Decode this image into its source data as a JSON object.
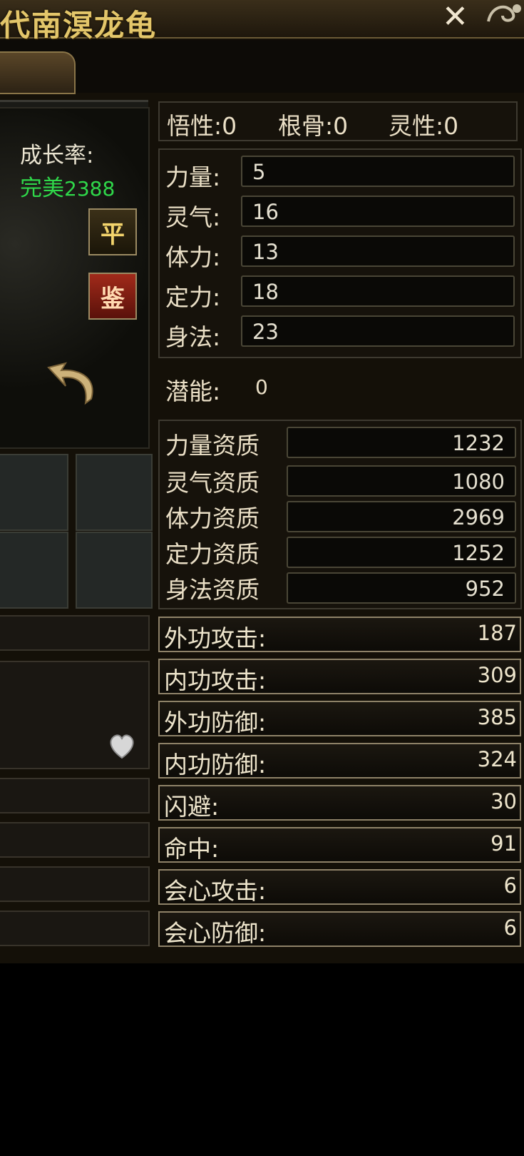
{
  "window": {
    "title": "代南溟龙龟",
    "close_glyph": "✕"
  },
  "top_stats": {
    "wuxing": "悟性:0",
    "gengu": "根骨:0",
    "lingxing": "灵性:0"
  },
  "growth": {
    "label": "成长率:",
    "grade": "完美",
    "value": "2388"
  },
  "buttons": {
    "ping": "平",
    "jian": "鉴"
  },
  "attributes": [
    {
      "label": "力量:",
      "value": "5"
    },
    {
      "label": "灵气:",
      "value": "16"
    },
    {
      "label": "体力:",
      "value": "13"
    },
    {
      "label": "定力:",
      "value": "18"
    },
    {
      "label": "身法:",
      "value": "23"
    }
  ],
  "potential": {
    "label": "潜能:",
    "value": "0"
  },
  "aptitudes": [
    {
      "label": "力量资质",
      "value": "1232"
    },
    {
      "label": "灵气资质",
      "value": "1080"
    },
    {
      "label": "体力资质",
      "value": "2969"
    },
    {
      "label": "定力资质",
      "value": "1252"
    },
    {
      "label": "身法资质",
      "value": "952"
    }
  ],
  "battle": [
    {
      "label": "外功攻击:",
      "value": "187"
    },
    {
      "label": "内功攻击:",
      "value": "309"
    },
    {
      "label": "外功防御:",
      "value": "385"
    },
    {
      "label": "内功防御:",
      "value": "324"
    },
    {
      "label": "闪避:",
      "value": "30"
    },
    {
      "label": "命中:",
      "value": "91"
    },
    {
      "label": "会心攻击:",
      "value": "6"
    },
    {
      "label": "会心防御:",
      "value": "6"
    }
  ],
  "colors": {
    "gold": "#e3c66a",
    "green": "#2fd84a",
    "text": "#eadfc6"
  },
  "icons": [
    "close-icon",
    "back-arrow-icon",
    "heart-icon",
    "ornament-icon"
  ]
}
